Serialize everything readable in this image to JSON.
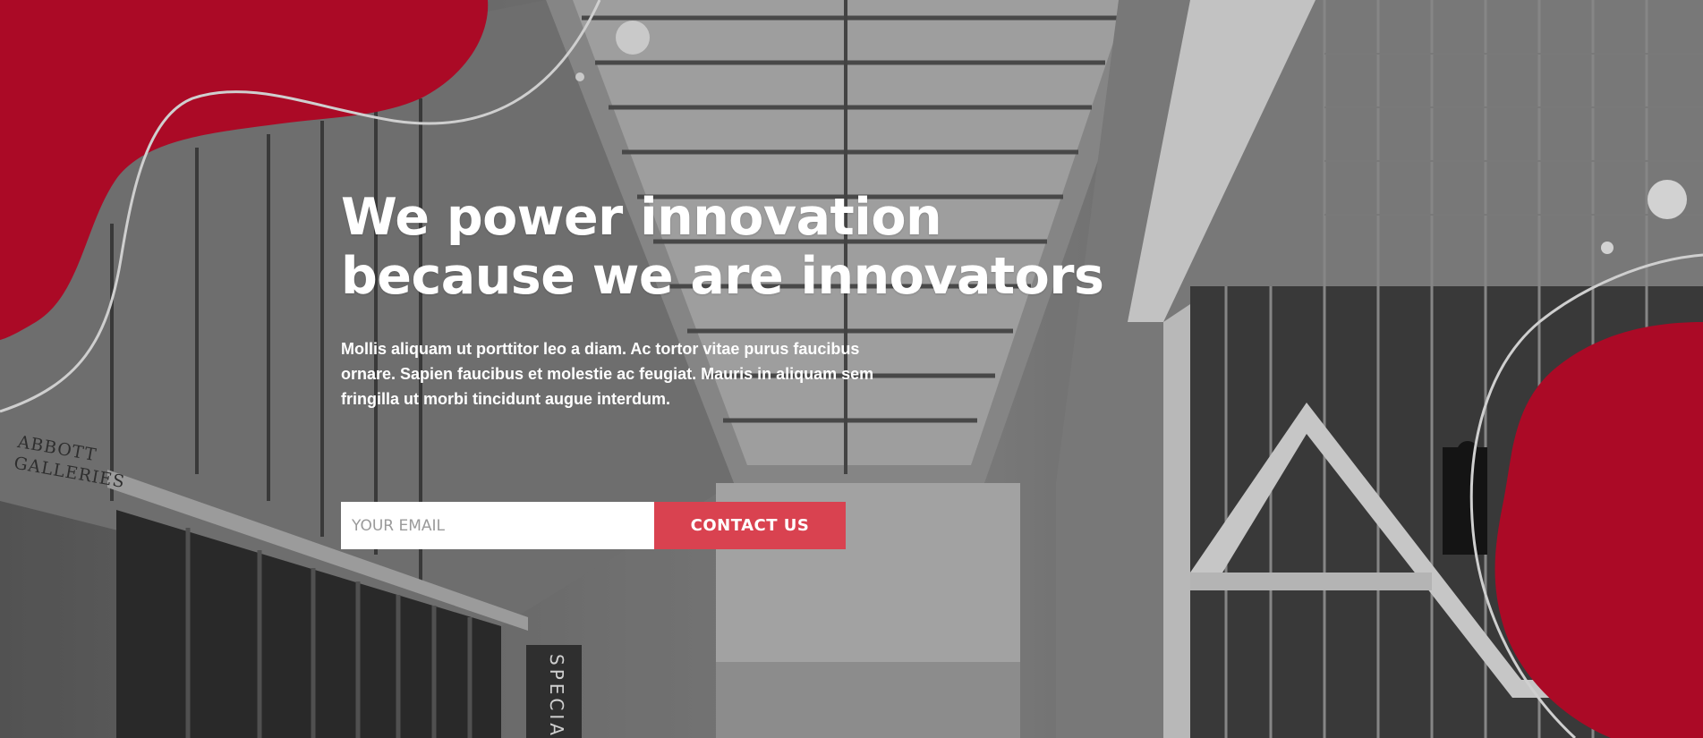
{
  "hero": {
    "headline_line1": "We power innovation",
    "headline_line2": "because we are innovators",
    "lead": "Mollis aliquam ut porttitor leo a diam. Ac tortor vitae purus faucibus ornare. Sapien faucibus et molestie ac feugiat. Mauris in aliquam sem fringilla ut morbi tincidunt augue interdum."
  },
  "form": {
    "email_placeholder": "YOUR EMAIL",
    "email_value": "",
    "contact_label": "CONTACT US"
  },
  "background": {
    "wall_sign_line1": "ABBOTT",
    "wall_sign_line2": "GALLERIES",
    "banner_sign": "SPECIAL"
  },
  "colors": {
    "brand_red": "#ab0a26",
    "button_red": "#d94250",
    "text_white": "#ffffff",
    "input_bg": "#ffffff"
  }
}
